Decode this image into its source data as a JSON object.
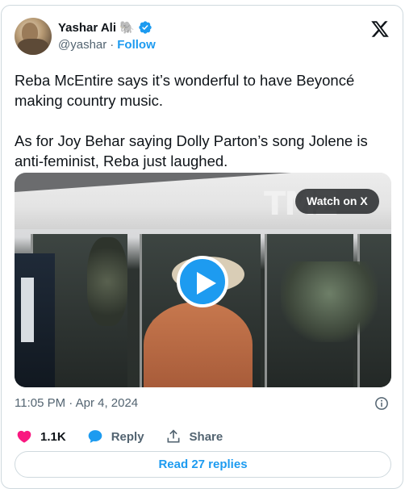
{
  "author": {
    "display_name": "Yashar Ali",
    "emoji": "🐘",
    "handle": "@yashar",
    "separator": "·",
    "follow_label": "Follow"
  },
  "tweet": {
    "paragraph_1": "Reba McEntire says it’s wonderful to have Beyoncé making country music.",
    "paragraph_2": "As for Joy Behar saying Dolly Parton’s song Jolene is anti-feminist, Reba just laughed."
  },
  "media": {
    "watermark": "TMZ",
    "watch_label": "Watch on X"
  },
  "meta": {
    "timestamp": "11:05 PM · Apr 4, 2024"
  },
  "actions": {
    "likes_count": "1.1K",
    "reply_label": "Reply",
    "share_label": "Share"
  },
  "read_replies_label": "Read 27 replies",
  "colors": {
    "accent": "#1d9bf0",
    "like": "#f91880",
    "muted_text": "#536471",
    "border": "#cfd9de"
  },
  "icons": [
    "verified-badge-icon",
    "x-logo-icon",
    "play-icon",
    "info-icon",
    "heart-icon",
    "reply-bubble-icon",
    "share-icon"
  ]
}
